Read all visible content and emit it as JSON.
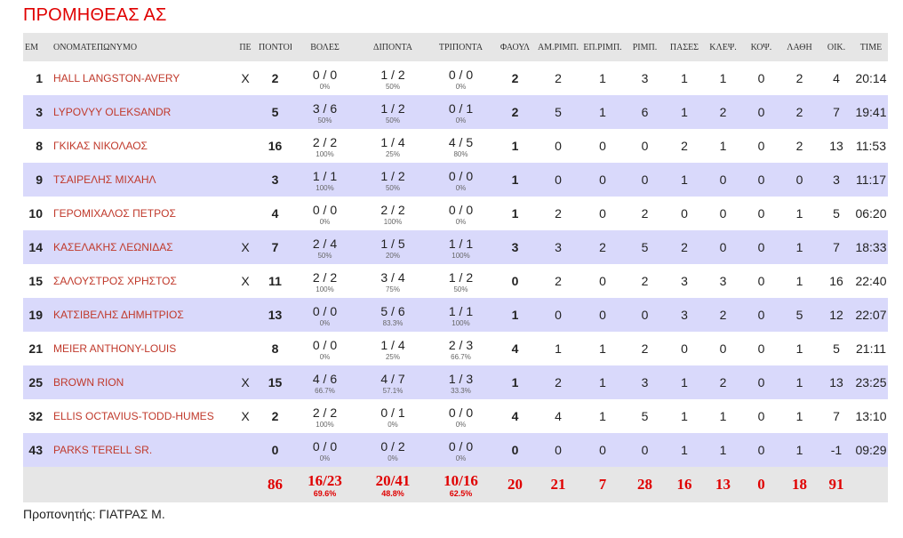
{
  "team": {
    "title": "ΠΡΟΜΗΘΕΑΣ ΑΣ",
    "title_color": "#e00000"
  },
  "headers": [
    "ΕΜ",
    "ΟΝΟΜΑΤΕΠΩΝΥΜΟ",
    "ΠΕ",
    "ΠΟΝΤΟΙ",
    "ΒΟΛΕΣ",
    "ΔΙΠΟΝΤΑ",
    "ΤΡΙΠΟΝΤΑ",
    "ΦΑΟΥΛ",
    "ΑΜ.ΡΙΜΠ.",
    "ΕΠ.ΡΙΜΠ.",
    "ΡΙΜΠ.",
    "ΠΑΣΕΣ",
    "ΚΛΕΨ.",
    "ΚΟΨ.",
    "ΛΑΘΗ",
    "ΟΙΚ.",
    "TIME"
  ],
  "players": [
    {
      "num": "1",
      "name": "HALL LANGSTON-AVERY",
      "starter": "X",
      "pts": "2",
      "ft": "0 / 0",
      "ft_pct": "0%",
      "fg2": "1 / 2",
      "fg2_pct": "50%",
      "fg3": "0 / 0",
      "fg3_pct": "0%",
      "fouls": "2",
      "dreb": "2",
      "oreb": "1",
      "reb": "3",
      "ast": "1",
      "stl": "1",
      "blk": "0",
      "to": "2",
      "eff": "4",
      "time": "20:14"
    },
    {
      "num": "3",
      "name": "LYPOVYY OLEKSANDR",
      "starter": "",
      "pts": "5",
      "ft": "3 / 6",
      "ft_pct": "50%",
      "fg2": "1 / 2",
      "fg2_pct": "50%",
      "fg3": "0 / 1",
      "fg3_pct": "0%",
      "fouls": "2",
      "dreb": "5",
      "oreb": "1",
      "reb": "6",
      "ast": "1",
      "stl": "2",
      "blk": "0",
      "to": "2",
      "eff": "7",
      "time": "19:41"
    },
    {
      "num": "8",
      "name": "ΓΚΙΚΑΣ ΝΙΚΟΛΑΟΣ",
      "starter": "",
      "pts": "16",
      "ft": "2 / 2",
      "ft_pct": "100%",
      "fg2": "1 / 4",
      "fg2_pct": "25%",
      "fg3": "4 / 5",
      "fg3_pct": "80%",
      "fouls": "1",
      "dreb": "0",
      "oreb": "0",
      "reb": "0",
      "ast": "2",
      "stl": "1",
      "blk": "0",
      "to": "2",
      "eff": "13",
      "time": "11:53"
    },
    {
      "num": "9",
      "name": "ΤΣΑΙΡΕΛΗΣ ΜΙΧΑΗΛ",
      "starter": "",
      "pts": "3",
      "ft": "1 / 1",
      "ft_pct": "100%",
      "fg2": "1 / 2",
      "fg2_pct": "50%",
      "fg3": "0 / 0",
      "fg3_pct": "0%",
      "fouls": "1",
      "dreb": "0",
      "oreb": "0",
      "reb": "0",
      "ast": "1",
      "stl": "0",
      "blk": "0",
      "to": "0",
      "eff": "3",
      "time": "11:17"
    },
    {
      "num": "10",
      "name": "ΓΕΡΟΜΙΧΑΛΟΣ ΠΕΤΡΟΣ",
      "starter": "",
      "pts": "4",
      "ft": "0 / 0",
      "ft_pct": "0%",
      "fg2": "2 / 2",
      "fg2_pct": "100%",
      "fg3": "0 / 0",
      "fg3_pct": "0%",
      "fouls": "1",
      "dreb": "2",
      "oreb": "0",
      "reb": "2",
      "ast": "0",
      "stl": "0",
      "blk": "0",
      "to": "1",
      "eff": "5",
      "time": "06:20"
    },
    {
      "num": "14",
      "name": "ΚΑΣΕΛΑΚΗΣ ΛΕΩΝΙΔΑΣ",
      "starter": "X",
      "pts": "7",
      "ft": "2 / 4",
      "ft_pct": "50%",
      "fg2": "1 / 5",
      "fg2_pct": "20%",
      "fg3": "1 / 1",
      "fg3_pct": "100%",
      "fouls": "3",
      "dreb": "3",
      "oreb": "2",
      "reb": "5",
      "ast": "2",
      "stl": "0",
      "blk": "0",
      "to": "1",
      "eff": "7",
      "time": "18:33"
    },
    {
      "num": "15",
      "name": "ΣΑΛΟΥΣΤΡΟΣ ΧΡΗΣΤΟΣ",
      "starter": "X",
      "pts": "11",
      "ft": "2 / 2",
      "ft_pct": "100%",
      "fg2": "3 / 4",
      "fg2_pct": "75%",
      "fg3": "1 / 2",
      "fg3_pct": "50%",
      "fouls": "0",
      "dreb": "2",
      "oreb": "0",
      "reb": "2",
      "ast": "3",
      "stl": "3",
      "blk": "0",
      "to": "1",
      "eff": "16",
      "time": "22:40"
    },
    {
      "num": "19",
      "name": "ΚΑΤΣΙΒΕΛΗΣ ΔΗΜΗΤΡΙΟΣ",
      "starter": "",
      "pts": "13",
      "ft": "0 / 0",
      "ft_pct": "0%",
      "fg2": "5 / 6",
      "fg2_pct": "83.3%",
      "fg3": "1 / 1",
      "fg3_pct": "100%",
      "fouls": "1",
      "dreb": "0",
      "oreb": "0",
      "reb": "0",
      "ast": "3",
      "stl": "2",
      "blk": "0",
      "to": "5",
      "eff": "12",
      "time": "22:07"
    },
    {
      "num": "21",
      "name": "MEIER ANTHONY-LOUIS",
      "starter": "",
      "pts": "8",
      "ft": "0 / 0",
      "ft_pct": "0%",
      "fg2": "1 / 4",
      "fg2_pct": "25%",
      "fg3": "2 / 3",
      "fg3_pct": "66.7%",
      "fouls": "4",
      "dreb": "1",
      "oreb": "1",
      "reb": "2",
      "ast": "0",
      "stl": "0",
      "blk": "0",
      "to": "1",
      "eff": "5",
      "time": "21:11"
    },
    {
      "num": "25",
      "name": "BROWN RION",
      "starter": "X",
      "pts": "15",
      "ft": "4 / 6",
      "ft_pct": "66.7%",
      "fg2": "4 / 7",
      "fg2_pct": "57.1%",
      "fg3": "1 / 3",
      "fg3_pct": "33.3%",
      "fouls": "1",
      "dreb": "2",
      "oreb": "1",
      "reb": "3",
      "ast": "1",
      "stl": "2",
      "blk": "0",
      "to": "1",
      "eff": "13",
      "time": "23:25"
    },
    {
      "num": "32",
      "name": "ELLIS OCTAVIUS-TODD-HUMES",
      "starter": "X",
      "pts": "2",
      "ft": "2 / 2",
      "ft_pct": "100%",
      "fg2": "0 / 1",
      "fg2_pct": "0%",
      "fg3": "0 / 0",
      "fg3_pct": "0%",
      "fouls": "4",
      "dreb": "4",
      "oreb": "1",
      "reb": "5",
      "ast": "1",
      "stl": "1",
      "blk": "0",
      "to": "1",
      "eff": "7",
      "time": "13:10"
    },
    {
      "num": "43",
      "name": "PARKS TERELL SR.",
      "starter": "",
      "pts": "0",
      "ft": "0 / 0",
      "ft_pct": "0%",
      "fg2": "0 / 2",
      "fg2_pct": "0%",
      "fg3": "0 / 0",
      "fg3_pct": "0%",
      "fouls": "0",
      "dreb": "0",
      "oreb": "0",
      "reb": "0",
      "ast": "1",
      "stl": "1",
      "blk": "0",
      "to": "1",
      "eff": "-1",
      "time": "09:29"
    }
  ],
  "totals": {
    "pts": "86",
    "ft": "16/23",
    "ft_pct": "69.6%",
    "fg2": "20/41",
    "fg2_pct": "48.8%",
    "fg3": "10/16",
    "fg3_pct": "62.5%",
    "fouls": "20",
    "dreb": "21",
    "oreb": "7",
    "reb": "28",
    "ast": "16",
    "stl": "13",
    "blk": "0",
    "to": "18",
    "eff": "91"
  },
  "coach": "Προπονητής: ΓΙΑΤΡΑΣ Μ.",
  "colors": {
    "accent": "#e00000",
    "name_link": "#c0392b",
    "row_alt": "#d9d9fb",
    "header_bg": "#e6e6e6"
  }
}
